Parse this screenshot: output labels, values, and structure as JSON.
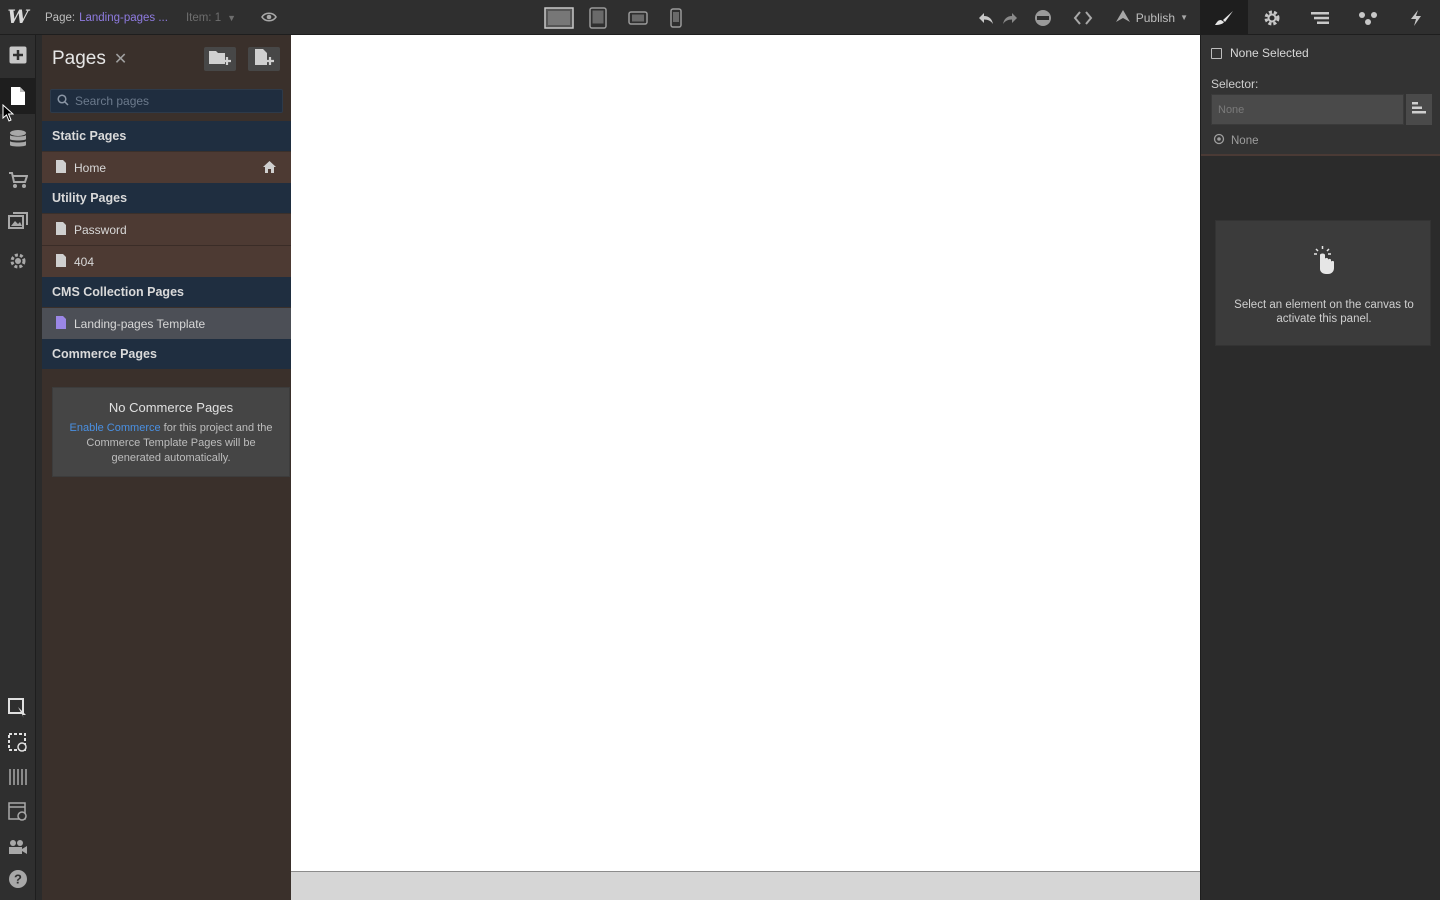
{
  "topbar": {
    "logo": "W",
    "page_label": "Page:",
    "page_name": "Landing-pages ...",
    "item_label": "Item: 1",
    "publish_label": "Publish",
    "icons": [
      "preview-eye-icon",
      "desktop-icon",
      "tablet-icon",
      "mobile-landscape-icon",
      "mobile-portrait-icon",
      "undo-icon",
      "redo-icon",
      "audit-icon",
      "code-icon",
      "publish-icon",
      "style-brush-icon",
      "settings-gear-icon",
      "navigator-icon",
      "interactions-icon",
      "lightning-icon"
    ]
  },
  "rail": {
    "icons": [
      "add-icon",
      "pages-icon",
      "cms-database-icon",
      "ecommerce-cart-icon",
      "assets-icon",
      "settings-icon",
      "select-parent-icon",
      "show-edges-icon",
      "x-ray-icon",
      "preview-icon",
      "video-tutorials-icon",
      "help-icon"
    ]
  },
  "pages": {
    "title": "Pages",
    "search_placeholder": "Search pages",
    "sections": {
      "static": "Static Pages",
      "utility": "Utility Pages",
      "cms": "CMS Collection Pages",
      "commerce": "Commerce Pages"
    },
    "static_pages": [
      {
        "name": "Home"
      }
    ],
    "utility_pages": [
      {
        "name": "Password"
      },
      {
        "name": "404"
      }
    ],
    "cms_pages": [
      {
        "name": "Landing-pages Template"
      }
    ],
    "commerce_empty": {
      "heading": "No Commerce Pages",
      "link": "Enable Commerce",
      "text": " for this project and the Commerce Template Pages will be generated automatically."
    }
  },
  "right_panel": {
    "none_selected": "None Selected",
    "selector_label": "Selector:",
    "selector_placeholder": "None",
    "state": "None",
    "hint": "Select an element on the canvas to activate this panel."
  },
  "colors": {
    "accent_purple": "#8e7be0",
    "link_blue": "#4a90e2",
    "section_bg": "#1f2e40"
  }
}
